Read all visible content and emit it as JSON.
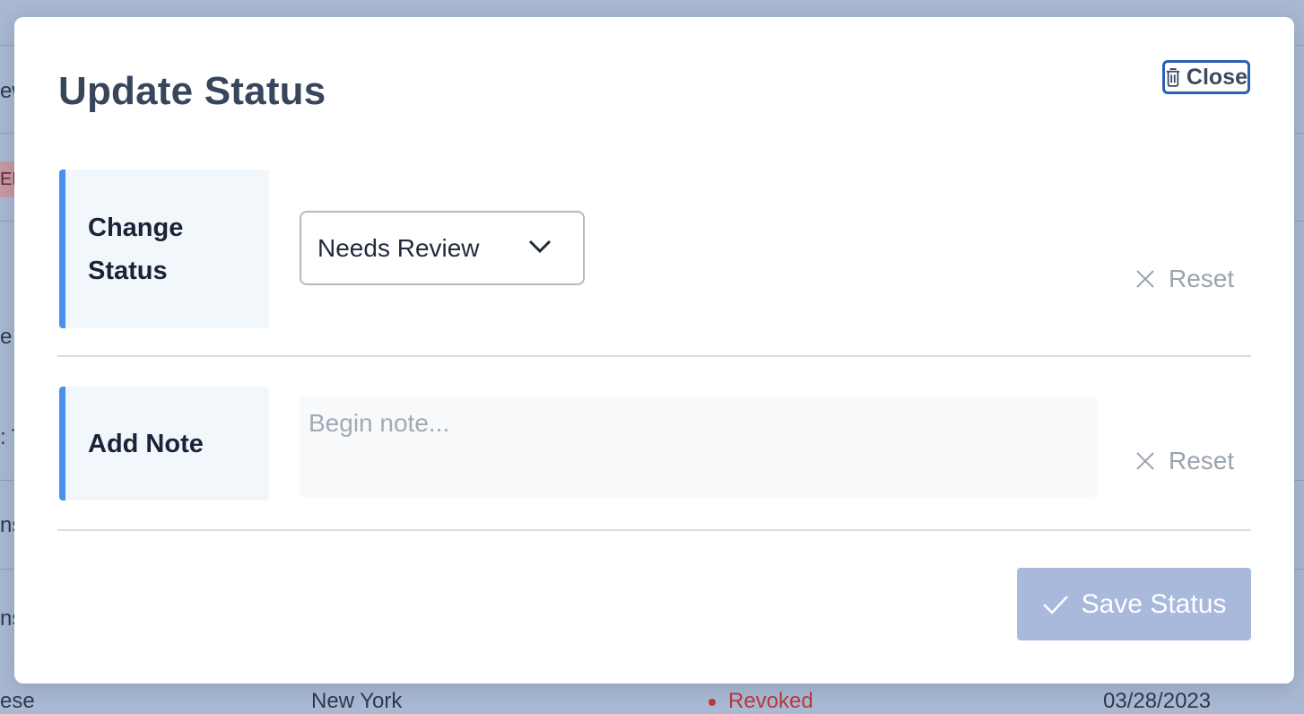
{
  "modal": {
    "title": "Update Status",
    "close_label": "Close",
    "change_status": {
      "label": "Change Status",
      "selected_value": "Needs Review",
      "reset_label": "Reset"
    },
    "add_note": {
      "label": "Add Note",
      "placeholder": "Begin note...",
      "value": "",
      "reset_label": "Reset"
    },
    "save_label": "Save Status"
  },
  "background": {
    "fragments": {
      "row1": "ew",
      "badge": "ED",
      "row3": "e",
      "row4": ": T",
      "row5": "ns",
      "row6": "ns",
      "row7_col1": "ese",
      "row7_col2": "New York",
      "row7_status": "Revoked",
      "row7_date": "03/28/2023"
    }
  },
  "colors": {
    "accent": "#4a90f0",
    "close_border": "#2c5fb3",
    "save_button_bg": "#a8b9dc",
    "overlay": "#a9b9d3",
    "revoked": "#b93b3b"
  }
}
